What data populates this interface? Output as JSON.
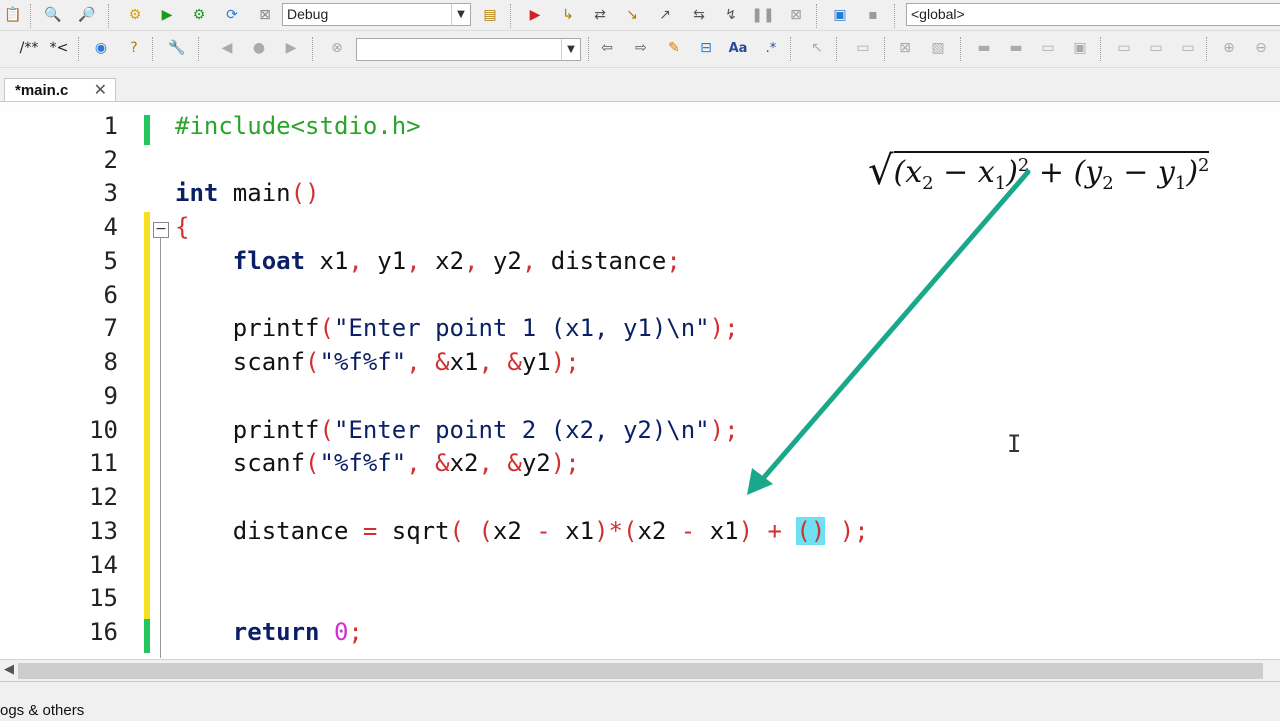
{
  "toolbar1": {
    "build_target": "Debug",
    "scope": "<global>"
  },
  "toolbar2": {
    "comment_block_label": "/**",
    "comment_line_label": "*<",
    "search_value": ""
  },
  "tab": {
    "title": "*main.c",
    "close_glyph": "✕"
  },
  "editor": {
    "line_numbers": [
      "1",
      "2",
      "3",
      "4",
      "5",
      "6",
      "7",
      "8",
      "9",
      "10",
      "11",
      "12",
      "13",
      "14",
      "15",
      "16"
    ],
    "lines": [
      "#include<stdio.h>",
      "",
      "int main()",
      "{",
      "    float x1, y1, x2, y2, distance;",
      "",
      "    printf(\"Enter point 1 (x1, y1)\\n\");",
      "    scanf(\"%f%f\", &x1, &y1);",
      "",
      "    printf(\"Enter point 2 (x2, y2)\\n\");",
      "    scanf(\"%f%f\", &x2, &y2);",
      "",
      "    distance = sqrt( (x2 - x1)*(x2 - x1) + () );",
      "",
      "",
      "    return 0;"
    ],
    "fold_marker": "−"
  },
  "formula": {
    "radical": "√",
    "x2": "x",
    "x2_sub": "2",
    "x1": "x",
    "x1_sub": "1",
    "y2": "y",
    "y2_sub": "2",
    "y1": "y",
    "y1_sub": "1",
    "exp": "2"
  },
  "annotation": {
    "arrow_color": "#1aa88a"
  },
  "bottom": {
    "logs_tab": "ogs & others"
  }
}
